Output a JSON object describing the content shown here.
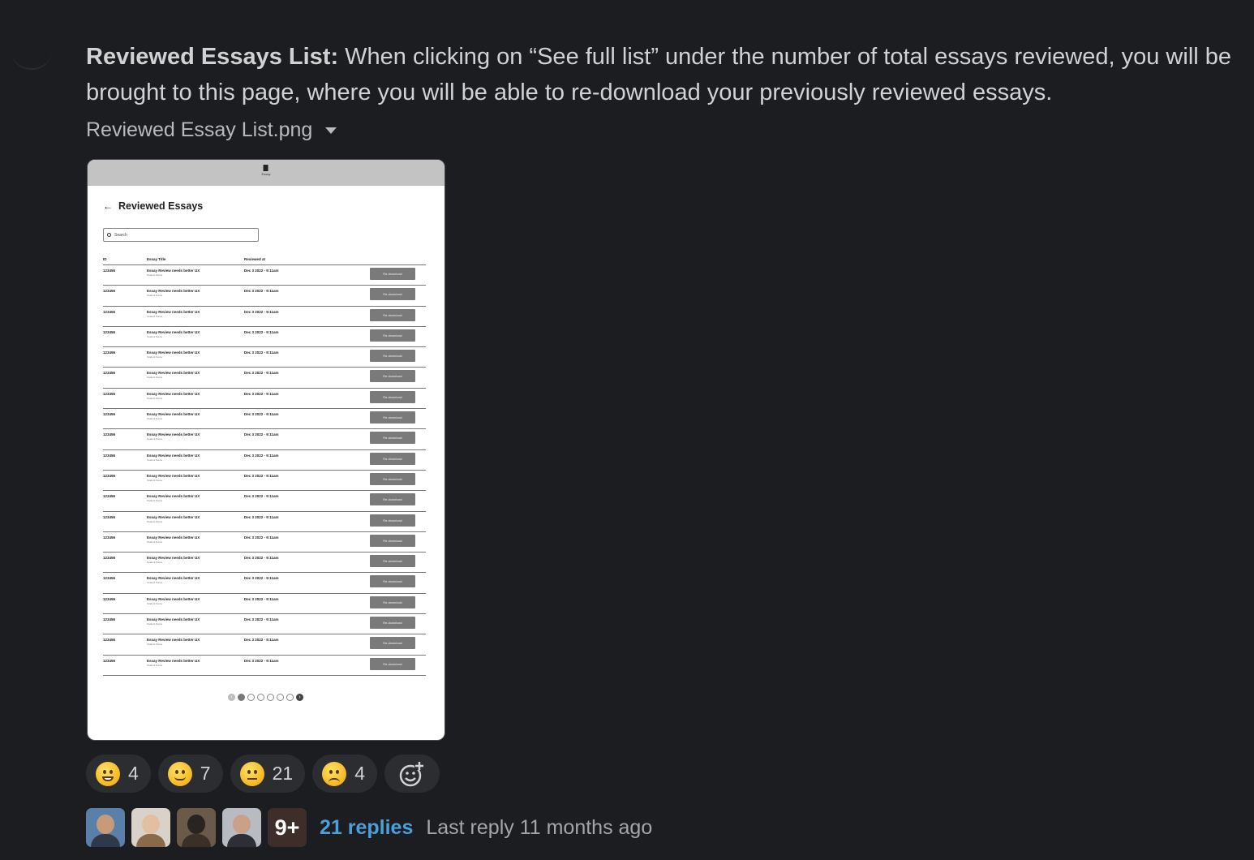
{
  "message": {
    "bold_lead": "Reviewed Essays List:",
    "text": " When clicking on “See full list” under the number of total essays reviewed, you will be brought to this page, where you will be able to re-download your previously reviewed essays."
  },
  "attachment": {
    "filename": "Reviewed Essay List.png"
  },
  "preview": {
    "logo_label": "Essay",
    "page_title": "Reviewed Essays",
    "search_placeholder": "Search",
    "columns": [
      "ID",
      "Essay Title",
      "Reviewed at"
    ],
    "rows": [
      {
        "id": "123456",
        "title": "Essay Review needs better UX",
        "student": "Student Name",
        "reviewed_at": "Dec 3 2022 - 9:11am",
        "action": "Re-download"
      },
      {
        "id": "123456",
        "title": "Essay Review needs better UX",
        "student": "Student Name",
        "reviewed_at": "Dec 3 2022 - 9:11am",
        "action": "Re-download"
      },
      {
        "id": "123456",
        "title": "Essay Review needs better UX",
        "student": "Student Name",
        "reviewed_at": "Dec 3 2022 - 9:11am",
        "action": "Re-download"
      },
      {
        "id": "123456",
        "title": "Essay Review needs better UX",
        "student": "Student Name",
        "reviewed_at": "Dec 3 2022 - 9:11am",
        "action": "Re-download"
      },
      {
        "id": "123456",
        "title": "Essay Review needs better UX",
        "student": "Student Name",
        "reviewed_at": "Dec 3 2022 - 9:11am",
        "action": "Re-download"
      },
      {
        "id": "123456",
        "title": "Essay Review needs better UX",
        "student": "Student Name",
        "reviewed_at": "Dec 3 2022 - 9:11am",
        "action": "Re-download"
      },
      {
        "id": "123456",
        "title": "Essay Review needs better UX",
        "student": "Student Name",
        "reviewed_at": "Dec 3 2022 - 9:11am",
        "action": "Re-download"
      },
      {
        "id": "123456",
        "title": "Essay Review needs better UX",
        "student": "Student Name",
        "reviewed_at": "Dec 3 2022 - 9:11am",
        "action": "Re-download"
      },
      {
        "id": "123456",
        "title": "Essay Review needs better UX",
        "student": "Student Name",
        "reviewed_at": "Dec 3 2022 - 9:11am",
        "action": "Re-download"
      },
      {
        "id": "123456",
        "title": "Essay Review needs better UX",
        "student": "Student Name",
        "reviewed_at": "Dec 3 2022 - 9:11am",
        "action": "Re-download"
      },
      {
        "id": "123456",
        "title": "Essay Review needs better UX",
        "student": "Student Name",
        "reviewed_at": "Dec 3 2022 - 9:11am",
        "action": "Re-download"
      },
      {
        "id": "123456",
        "title": "Essay Review needs better UX",
        "student": "Student Name",
        "reviewed_at": "Dec 3 2022 - 9:11am",
        "action": "Re-download"
      },
      {
        "id": "123456",
        "title": "Essay Review needs better UX",
        "student": "Student Name",
        "reviewed_at": "Dec 3 2022 - 9:11am",
        "action": "Re-download"
      },
      {
        "id": "123456",
        "title": "Essay Review needs better UX",
        "student": "Student Name",
        "reviewed_at": "Dec 3 2022 - 9:11am",
        "action": "Re-download"
      },
      {
        "id": "123456",
        "title": "Essay Review needs better UX",
        "student": "Student Name",
        "reviewed_at": "Dec 3 2022 - 9:11am",
        "action": "Re-download"
      },
      {
        "id": "123456",
        "title": "Essay Review needs better UX",
        "student": "Student Name",
        "reviewed_at": "Dec 3 2022 - 9:11am",
        "action": "Re-download"
      },
      {
        "id": "123456",
        "title": "Essay Review needs better UX",
        "student": "Student Name",
        "reviewed_at": "Dec 3 2022 - 9:11am",
        "action": "Re-download"
      },
      {
        "id": "123456",
        "title": "Essay Review needs better UX",
        "student": "Student Name",
        "reviewed_at": "Dec 3 2022 - 9:11am",
        "action": "Re-download"
      },
      {
        "id": "123456",
        "title": "Essay Review needs better UX",
        "student": "Student Name",
        "reviewed_at": "Dec 3 2022 - 9:11am",
        "action": "Re-download"
      },
      {
        "id": "123456",
        "title": "Essay Review needs better UX",
        "student": "Student Name",
        "reviewed_at": "Dec 3 2022 - 9:11am",
        "action": "Re-download"
      }
    ],
    "pagination": {
      "pages": 6,
      "current": 1
    }
  },
  "reactions": [
    {
      "emoji": "grinning-face",
      "count": "4"
    },
    {
      "emoji": "slightly-smiling-face",
      "count": "7"
    },
    {
      "emoji": "neutral-face",
      "count": "21"
    },
    {
      "emoji": "disappointed-face",
      "count": "4"
    }
  ],
  "add_reaction_icon": "add-emoji-icon",
  "thread": {
    "more_count": "9+",
    "replies": "21 replies",
    "last_reply": "Last reply 11 months ago"
  },
  "colors": {
    "background": "#1c1d21",
    "link": "#4ba0d8",
    "text": "#d1d2d3"
  }
}
